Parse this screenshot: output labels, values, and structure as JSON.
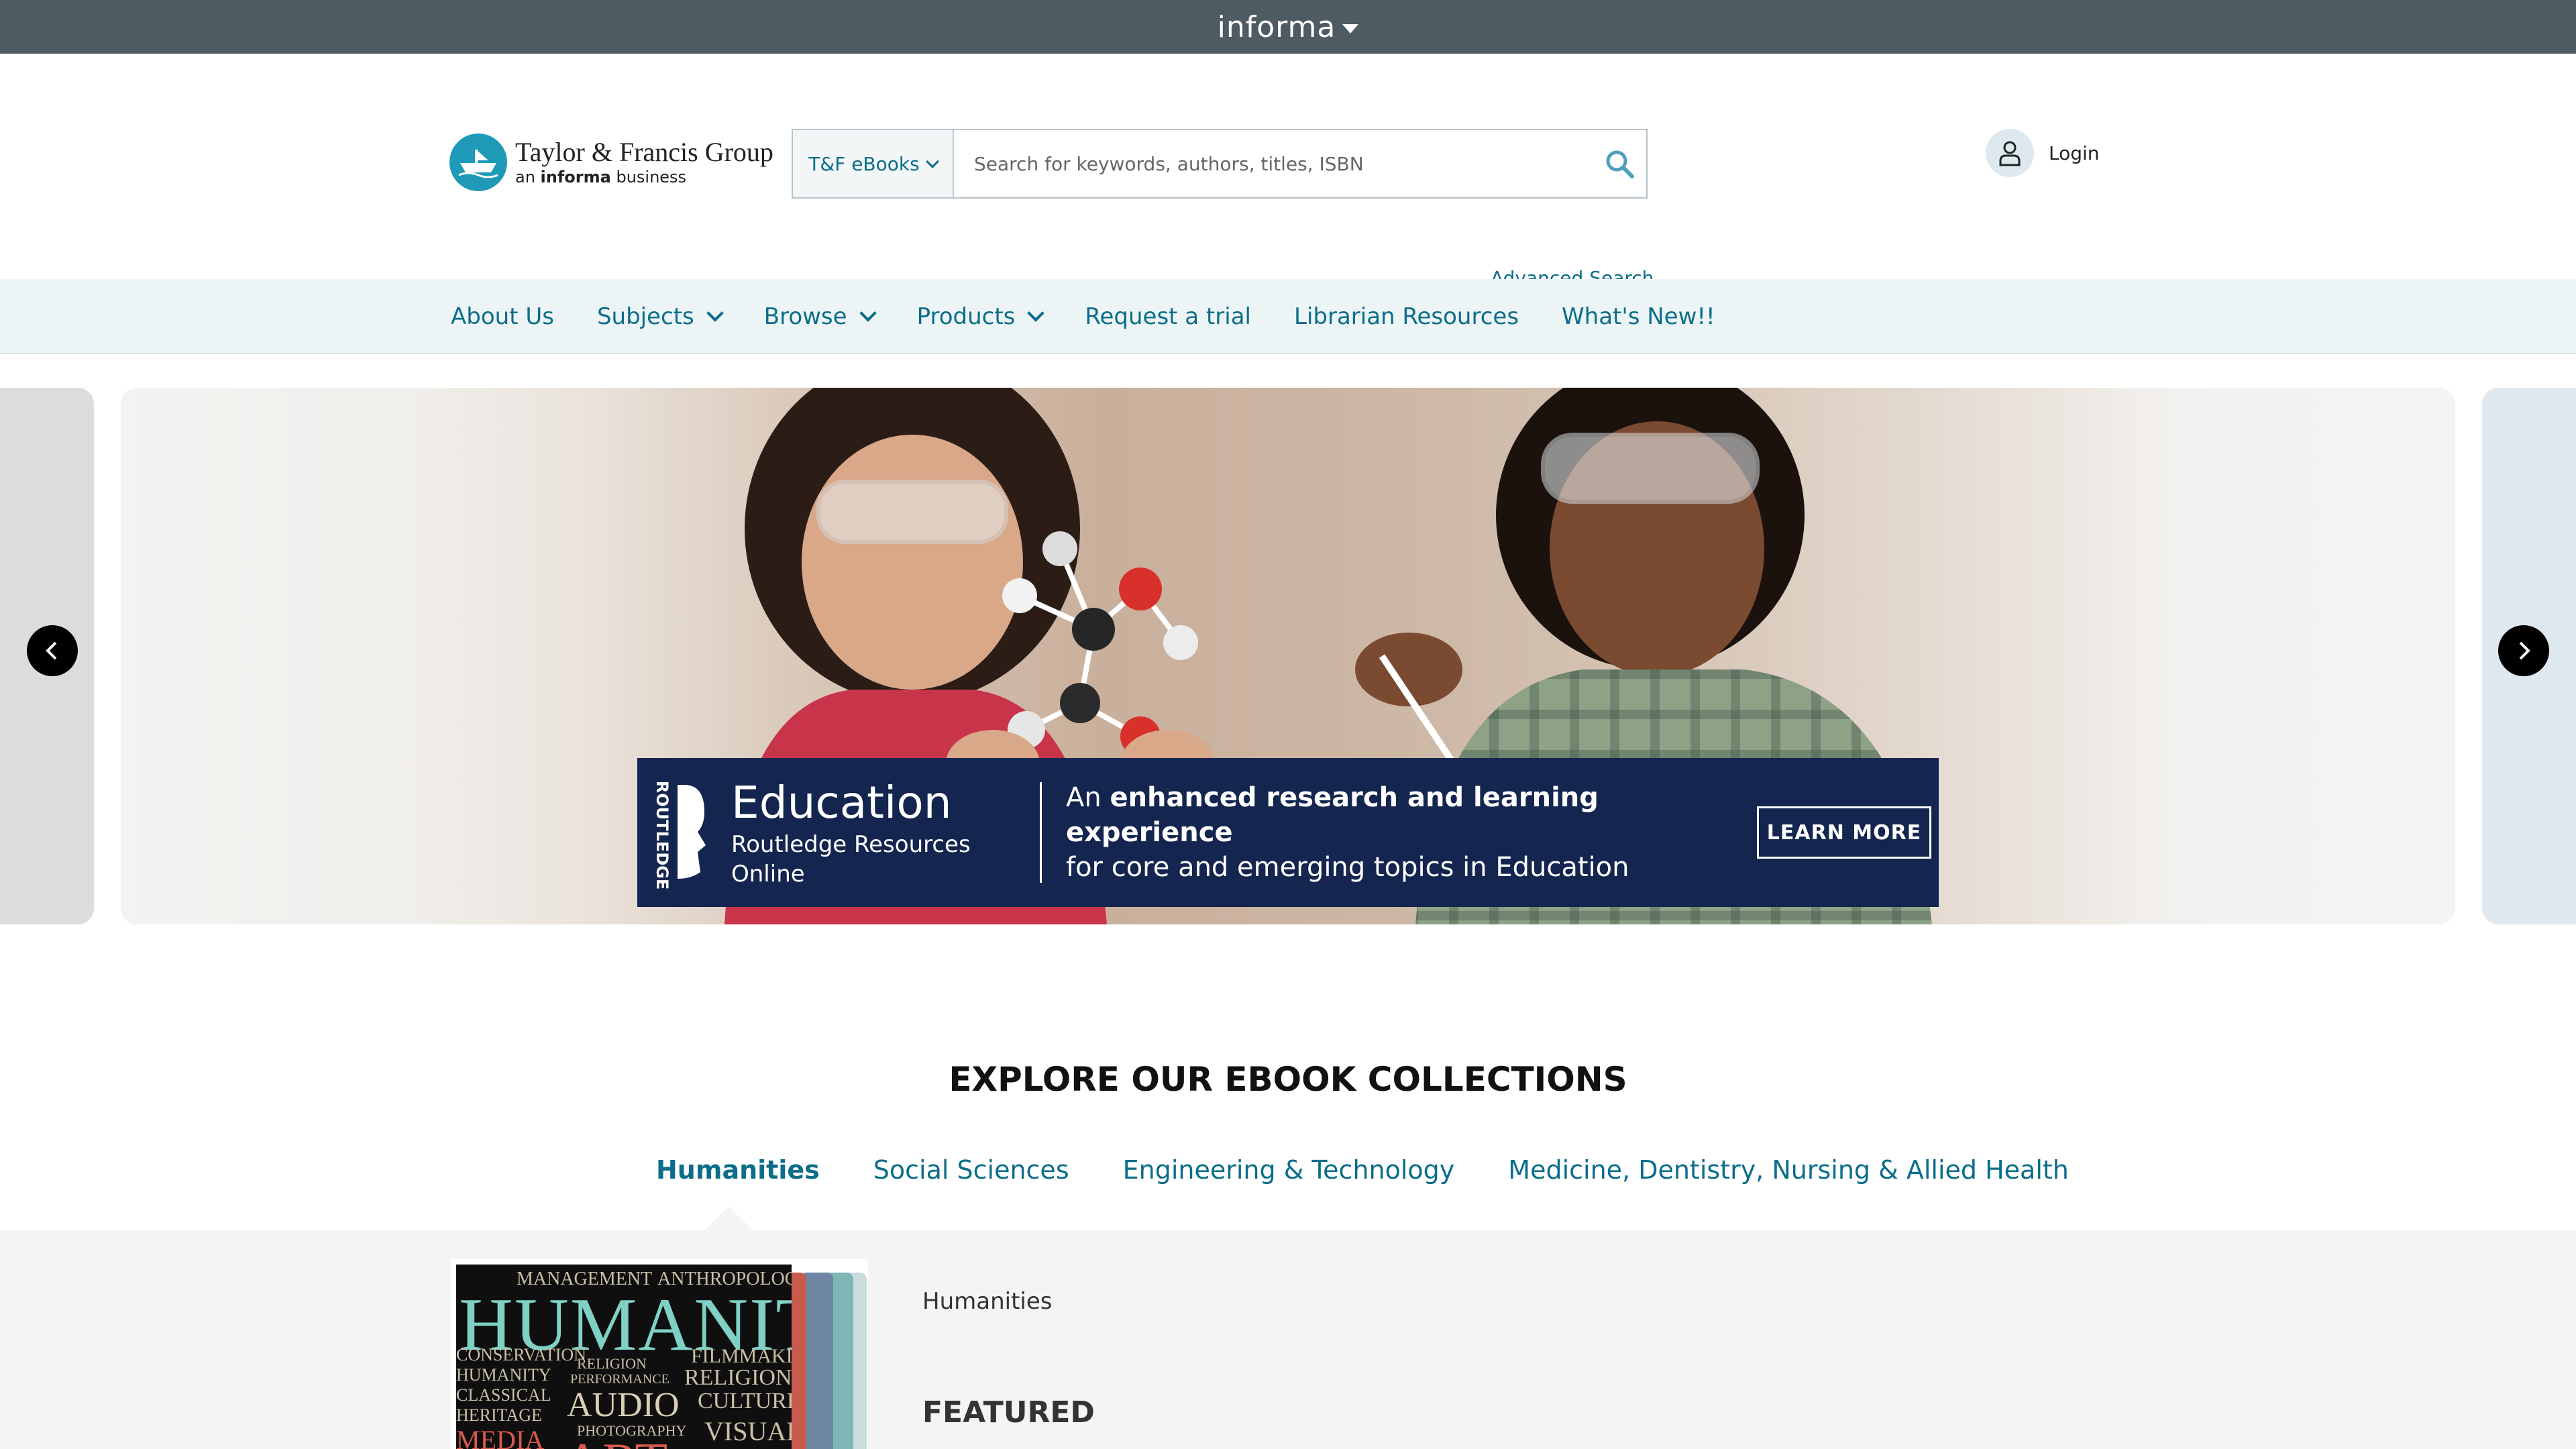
{
  "top_bar": {
    "brand": "informa"
  },
  "header": {
    "logo": {
      "line1": "Taylor & Francis Group",
      "line2_prefix": "an ",
      "line2_bold": "informa",
      "line2_suffix": " business"
    },
    "search": {
      "scope": "T&F eBooks",
      "placeholder": "Search for keywords, authors, titles, ISBN",
      "value": ""
    },
    "advanced_search": "Advanced Search",
    "login": "Login"
  },
  "nav": {
    "items": [
      {
        "label": "About Us",
        "has_dropdown": false
      },
      {
        "label": "Subjects",
        "has_dropdown": true
      },
      {
        "label": "Browse",
        "has_dropdown": true
      },
      {
        "label": "Products",
        "has_dropdown": true
      },
      {
        "label": "Request a trial",
        "has_dropdown": false
      },
      {
        "label": "Librarian Resources",
        "has_dropdown": false
      },
      {
        "label": "What's New!!",
        "has_dropdown": false
      }
    ]
  },
  "carousel": {
    "banner": {
      "publisher": "ROUTLEDGE",
      "title": "Education",
      "subtitle": "Routledge Resources Online",
      "msg_prefix": "An ",
      "msg_bold": "enhanced research and learning experience",
      "msg_line2": "for core and emerging topics in Education",
      "cta": "LEARN MORE"
    }
  },
  "explore": {
    "title": "EXPLORE OUR EBOOK COLLECTIONS",
    "tabs": [
      {
        "label": "Humanities",
        "active": true
      },
      {
        "label": "Social Sciences",
        "active": false
      },
      {
        "label": "Engineering & Technology",
        "active": false
      },
      {
        "label": "Medicine, Dentistry, Nursing & Allied Health",
        "active": false
      }
    ],
    "panel": {
      "collection_label": "Humanities",
      "featured": "FEATURED",
      "cover_words": {
        "w1": "MANAGEMENT",
        "w2": "ANTHROPOLOGY",
        "w3": "HUMANITY",
        "w4": "CONSERVATION",
        "w5": "FILMMAKING",
        "w6": "RELIGION",
        "w7": "PERFORMANCE",
        "w8": "HUMANITY",
        "w9": "RELIGION",
        "w10": "CLASSICAL",
        "w11": "AUDIO",
        "w12": "CULTURE",
        "w13": "HERITAGE",
        "w14": "PHOTOGRAPHY",
        "w15": "MEDIA",
        "w16": "VISUAL",
        "w17": "ART"
      }
    }
  },
  "colors": {
    "brand_teal": "#0b6d8a",
    "informa_bar": "#4f5b62",
    "banner_navy": "#14254f",
    "nav_bg": "#edf4f6"
  }
}
